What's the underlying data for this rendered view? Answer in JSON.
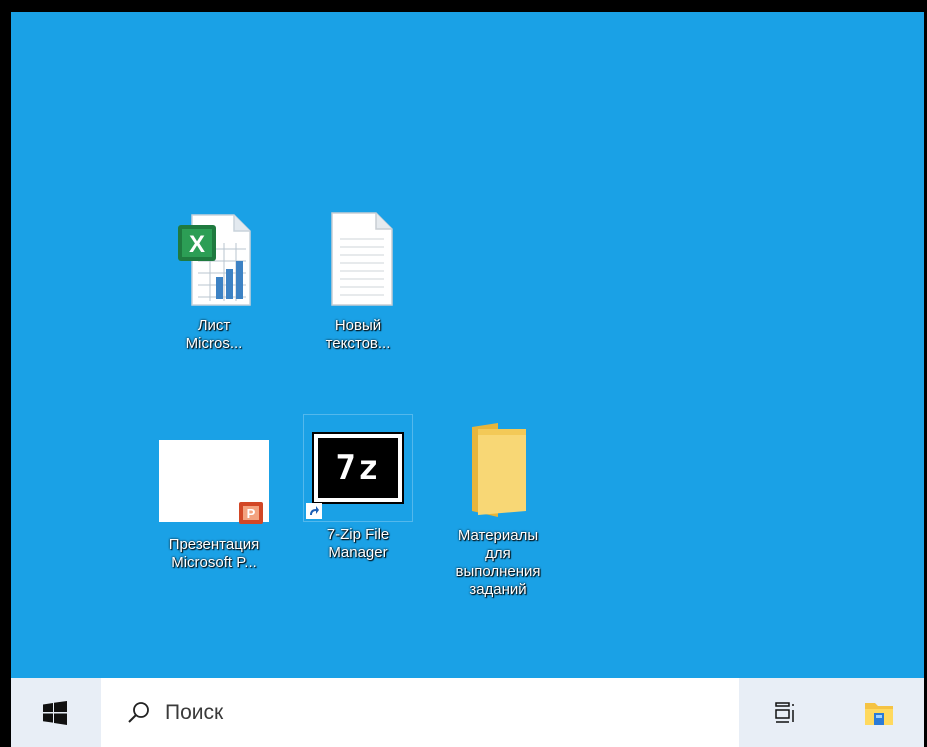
{
  "desktop": {
    "background_color": "#1aa1e6",
    "icons": [
      {
        "label": "Лист\nMicros...",
        "icon": "excel-sheet-icon"
      },
      {
        "label": "Новый\nтекстов...",
        "icon": "text-document-icon"
      },
      {
        "label": "Презентация\nMicrosoft P...",
        "icon": "powerpoint-presentation-icon"
      },
      {
        "label": "7-Zip File\nManager",
        "icon": "7zip-icon",
        "badge_text": "7z"
      },
      {
        "label": "Материалы\nдля\nвыполнения\nзаданий",
        "icon": "folder-icon"
      }
    ]
  },
  "taskbar": {
    "start_icon": "windows-logo-icon",
    "search": {
      "placeholder": "Поиск",
      "icon": "search-icon"
    },
    "task_view_icon": "task-view-icon",
    "explorer_icon": "file-explorer-icon"
  }
}
